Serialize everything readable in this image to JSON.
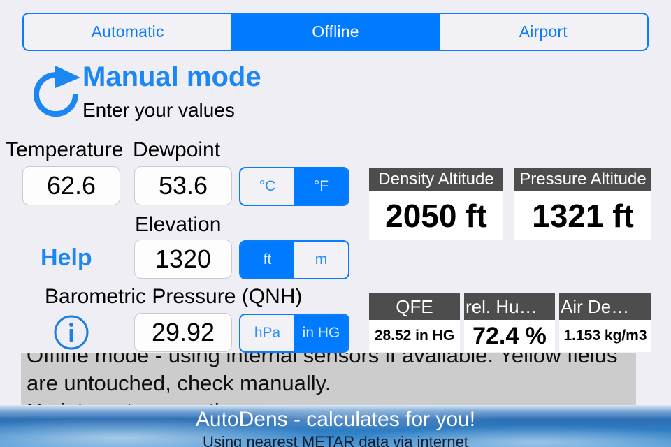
{
  "mode_tabs": {
    "items": [
      {
        "label": "Automatic",
        "selected": false
      },
      {
        "label": "Offline",
        "selected": true
      },
      {
        "label": "Airport",
        "selected": false
      }
    ]
  },
  "header": {
    "icon": "refresh-circular-arrow-icon",
    "title": "Manual mode",
    "subtitle": "Enter your values"
  },
  "inputs": {
    "temperature": {
      "label": "Temperature",
      "value": "62.6"
    },
    "dewpoint": {
      "label": "Dewpoint",
      "value": "53.6"
    },
    "elevation": {
      "label": "Elevation",
      "value": "1320"
    },
    "pressure": {
      "label": "Barometric Pressure (QNH)",
      "value": "29.92"
    }
  },
  "toggles": {
    "temperature_unit": {
      "options": [
        "°C",
        "°F"
      ],
      "selected": "°F"
    },
    "elevation_unit": {
      "options": [
        "ft",
        "m"
      ],
      "selected": "ft"
    },
    "pressure_unit": {
      "options": [
        "hPa",
        "in HG"
      ],
      "selected": "in HG"
    }
  },
  "links": {
    "help": "Help",
    "info_icon": "info-circle-icon"
  },
  "results": {
    "density_altitude": {
      "title": "Density Altitude",
      "value": "2050 ft"
    },
    "pressure_altitude": {
      "title": "Pressure Altitude",
      "value": "1321 ft"
    },
    "qfe": {
      "title": "QFE",
      "value": "28.52 in HG"
    },
    "relative_humidity": {
      "title": "rel. Hu…",
      "value": "72.4 %"
    },
    "air_density": {
      "title": "Air De…",
      "value": "1.153 kg/m3"
    }
  },
  "note": {
    "line1": "Offline mode - using internal sensors if available. Yellow fields",
    "line2": "are untouched, check manually.",
    "line3": "No internet connection."
  },
  "banner": {
    "title": "AutoDens - calculates for you!",
    "subtitle": "Using nearest METAR data via internet"
  },
  "colors": {
    "accent_blue": "#007AFF",
    "title_blue": "#1C86F2",
    "page_background": "#EFEEF4",
    "card_header": "#4D4D4D",
    "note_background": "#CCCCCC"
  }
}
